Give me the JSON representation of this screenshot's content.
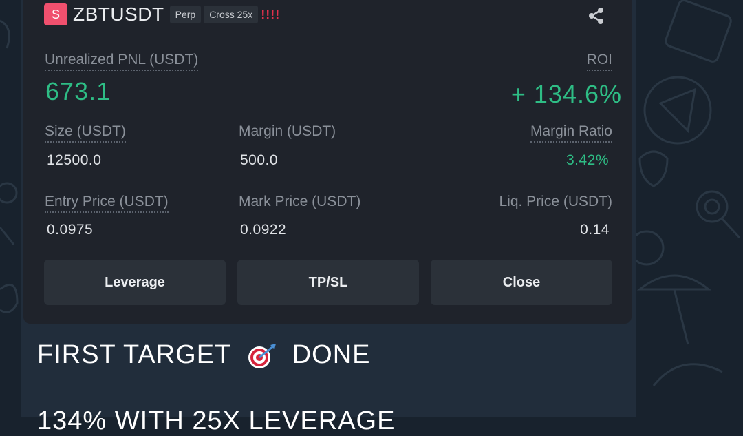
{
  "position": {
    "symbol_badge": "S",
    "symbol": "ZBTUSDT",
    "tag_type": "Perp",
    "tag_margin": "Cross 25x",
    "alert_marks": "!!!!",
    "unrealized_pnl_label": "Unrealized PNL (USDT)",
    "unrealized_pnl_value": "673.1",
    "roi_label": "ROI",
    "roi_value": "+ 134.6%",
    "size_label": "Size (USDT)",
    "size_value": "12500.0",
    "margin_label": "Margin (USDT)",
    "margin_value": "500.0",
    "margin_ratio_label": "Margin Ratio",
    "margin_ratio_value": "3.42%",
    "entry_price_label": "Entry Price (USDT)",
    "entry_price_value": "0.0975",
    "mark_price_label": "Mark Price (USDT)",
    "mark_price_value": "0.0922",
    "liq_price_label": "Liq. Price (USDT)",
    "liq_price_value": "0.14"
  },
  "actions": {
    "leverage": "Leverage",
    "tpsl": "TP/SL",
    "close": "Close"
  },
  "message": {
    "line1_before": "FIRST TARGET",
    "line1_after": "DONE",
    "line2": "134% WITH 25X LEVERAGE"
  },
  "icons": {
    "share": "share-icon",
    "target": "dart-target-icon"
  },
  "colors": {
    "profit_green": "#2ebd85",
    "badge_red": "#f0506e",
    "alert_red": "#e0314b"
  }
}
